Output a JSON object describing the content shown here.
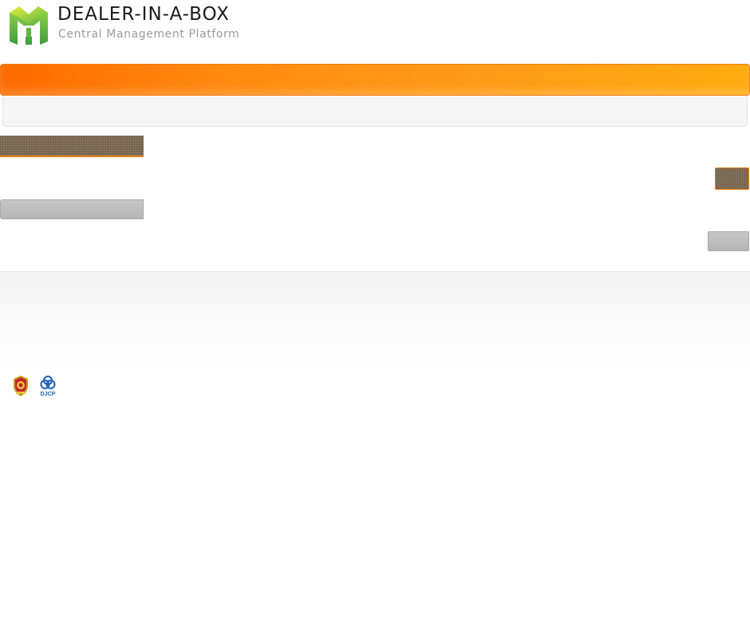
{
  "header": {
    "title": "DEALER-IN-A-BOX",
    "subtitle": "Central Management Platform",
    "logo_icon": "dealer-in-a-box-logo-icon"
  },
  "footer": {
    "badges": [
      {
        "icon": "police-emblem-icon"
      },
      {
        "icon": "djcp-certification-icon",
        "text": "DJCP"
      }
    ]
  },
  "colors": {
    "nav_gradient_start": "#ff6a00",
    "nav_gradient_end": "#ffab10",
    "accent_border": "#f07a10",
    "texture_brown": "#7c6a55",
    "grey_block": "#b4b4b4",
    "logo_green": "#7ac943",
    "logo_yellow": "#d8e81a",
    "djcp_blue": "#1e5fb8"
  }
}
